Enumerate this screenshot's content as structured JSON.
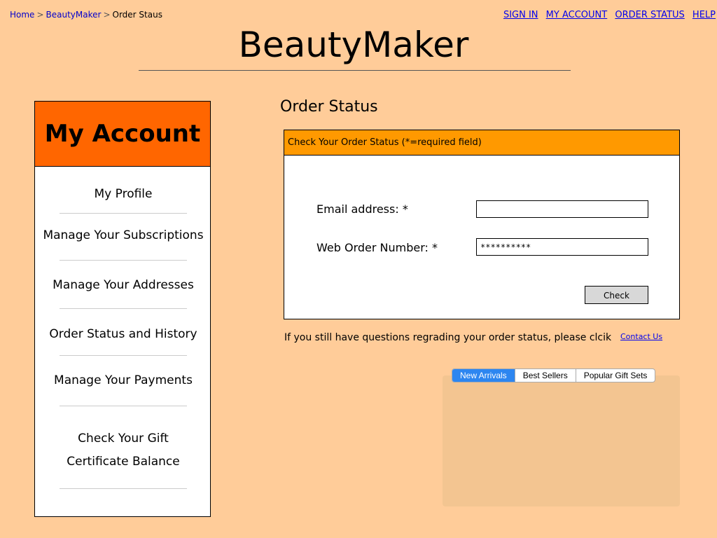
{
  "breadcrumb": [
    {
      "label": "Home",
      "link": true
    },
    {
      "label": "BeautyMaker",
      "link": true
    },
    {
      "label": "Order Staus",
      "link": false
    }
  ],
  "toplinks": [
    "SIGN IN",
    "MY ACCOUNT",
    "ORDER STATUS",
    "HELP"
  ],
  "brand": "BeautyMaker",
  "account": {
    "title": "My Account",
    "items": [
      "My Profile",
      "Manage Your Subscriptions",
      "Manage Your Addresses",
      "Order Status and History",
      "Manage Your Payments",
      "Check Your Gift",
      "Certificate Balance"
    ]
  },
  "order": {
    "title": "Order Status",
    "box_header": "Check Your Order Status (*=required field)",
    "email_label": "Email address: *",
    "email_value": "",
    "web_order_label": "Web Order Number: *",
    "web_order_value": "**********",
    "check_label": "Check",
    "help_text": "If you still have questions regrading your order status, please clcik",
    "contact_link": "Contact Us"
  },
  "tabs": {
    "items": [
      "New Arrivals",
      "Best Sellers",
      "Popular Gift Sets"
    ],
    "active": "New Arrivals"
  },
  "colors": {
    "page_bg": "#ffcc99",
    "account_header": "#ff6600",
    "box_header": "#ff9900",
    "tab_active": "#2d86f0"
  }
}
